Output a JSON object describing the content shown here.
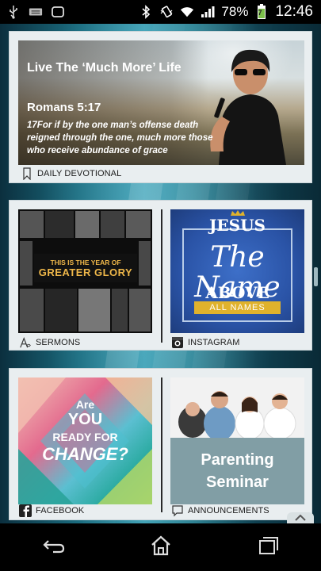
{
  "status_bar": {
    "battery_percent": "78%",
    "battery_level": "7",
    "time": "12:46"
  },
  "cards": {
    "devotional": {
      "title": "Live The ‘Much More’ Life",
      "reference": "Romans 5:17",
      "verse": "17For if by the one man’s offense death reigned through the one, much more those who receive abundance of grace",
      "label": "DAILY DEVOTIONAL"
    },
    "sermons": {
      "banner_line1": "THIS IS THE YEAR OF",
      "banner_line2": "GREATER GLORY",
      "label": "SERMONS"
    },
    "instagram": {
      "line1": "JESUS",
      "line2": "The Name",
      "line3": "ABOVE",
      "line4": "ALL NAMES",
      "label": "INSTAGRAM"
    },
    "facebook": {
      "line1": "Are",
      "line2": "YOU",
      "line3": "READY FOR",
      "line4": "CHANGE?",
      "label": "FACEBOOK"
    },
    "announcements": {
      "line1": "Parenting",
      "line2": "Seminar",
      "label": "ANNOUNCEMENTS"
    }
  },
  "icons": {
    "status_left": [
      "usb-icon",
      "keyboard-icon",
      "screenshot-icon"
    ],
    "status_right": [
      "bluetooth-icon",
      "vibrate-icon",
      "wifi-icon",
      "signal-icon",
      "battery-icon"
    ],
    "nav": [
      "back-icon",
      "home-icon",
      "recent-apps-icon"
    ]
  },
  "colors": {
    "card_bg": "#e9eef0",
    "instagram_blue": "#2a53a6",
    "gold": "#e0b22c",
    "announcement_box": "#819ea5"
  }
}
